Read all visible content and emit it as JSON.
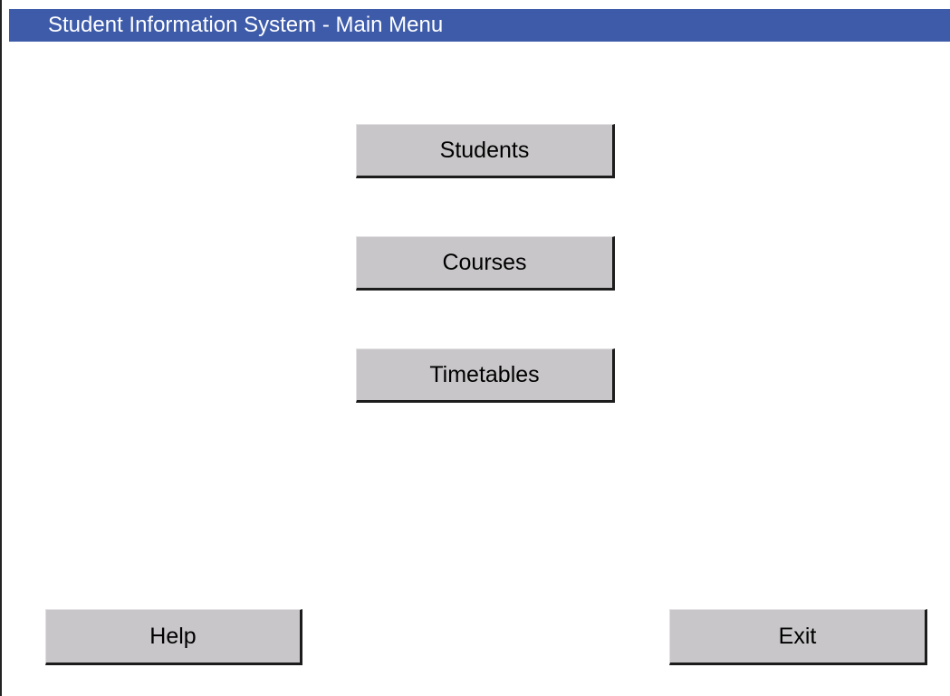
{
  "window": {
    "title": "Student Information System - Main Menu",
    "title_bar_color": "#3d5ba9"
  },
  "menu": {
    "students_label": "Students",
    "courses_label": "Courses",
    "timetables_label": "Timetables"
  },
  "footer": {
    "help_label": "Help",
    "exit_label": "Exit"
  },
  "colors": {
    "button_face": "#c8c6c8",
    "button_shadow": "#1c1c1c"
  }
}
